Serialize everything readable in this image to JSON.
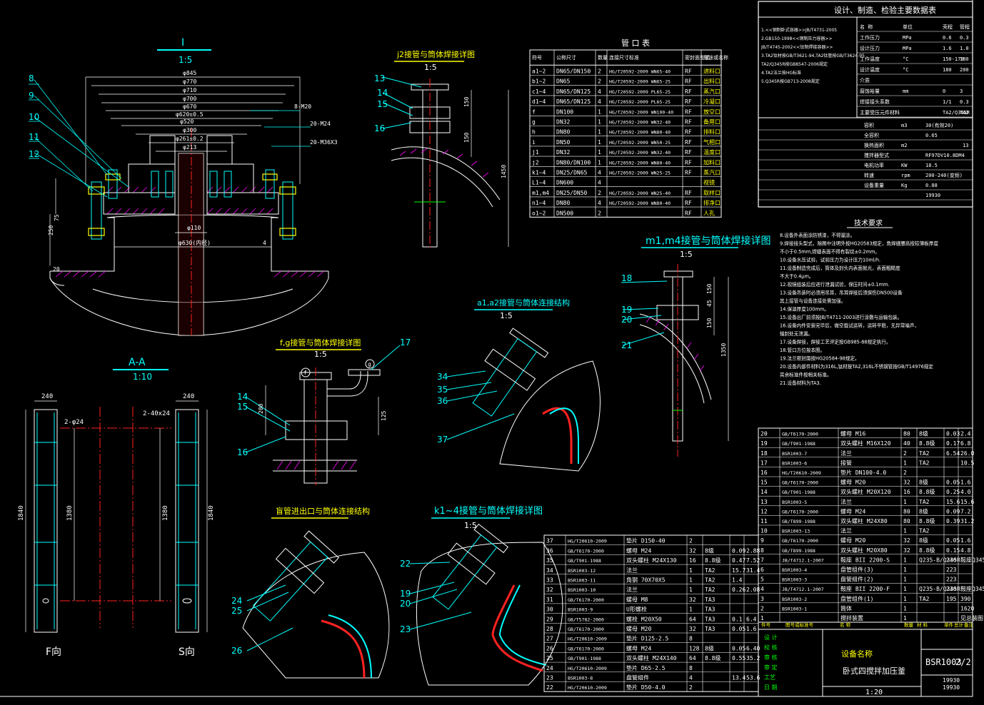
{
  "colors": {
    "bg": "#000000",
    "line": "#ffffff",
    "cyan": "#00ffff",
    "yellow": "#ffff00",
    "red": "#ff2020",
    "green": "#00ff00",
    "magenta": "#ff00ff",
    "blue": "#0080ff"
  },
  "views": {
    "section_I": {
      "title": "I",
      "scale": "1:5",
      "dims": [
        "φ845",
        "φ770",
        "φ710",
        "φ700",
        "φ670",
        "φ620±0.5",
        "φ520",
        "φ300",
        "φ261±0.2",
        "φ213",
        "φ110",
        "φ630(内径)",
        "250",
        "20",
        "75",
        "4",
        "8-M20",
        "20-M24",
        "20-M36X3"
      ],
      "callouts": [
        "8",
        "9",
        "10",
        "11",
        "12"
      ]
    },
    "section_AA": {
      "title": "A-A",
      "scale": "1:10",
      "left_label": "F向",
      "right_label": "S向",
      "dims": [
        "240",
        "240",
        "1840",
        "1840",
        "1380",
        "1380",
        "2-φ24",
        "2-40x24"
      ]
    },
    "j2": {
      "title": "j2接管与筒体焊接详图",
      "scale": "1:5",
      "callouts": [
        "13",
        "14",
        "15",
        "16"
      ],
      "dims": [
        "150",
        "150",
        "1450"
      ]
    },
    "fg": {
      "title": "f,g接管与筒体焊接详图",
      "scale": "1:5",
      "callouts": [
        "14",
        "15",
        "16",
        "17"
      ],
      "dims": [
        "200",
        "125"
      ]
    },
    "a12": {
      "title": "a1,a2接管与筒体连接结构",
      "scale": "1:5",
      "callouts": [
        "34",
        "35",
        "36",
        "37"
      ]
    },
    "m1m4": {
      "title": "m1,m4接管与筒体焊接详图",
      "scale": "1:5",
      "callouts": [
        "18",
        "19",
        "20",
        "21"
      ],
      "dims": [
        "150",
        "45",
        "150",
        "1350"
      ]
    },
    "blind": {
      "title": "盲管进出口与筒体连接结构",
      "callouts": [
        "24",
        "25",
        "26"
      ]
    },
    "k14": {
      "title": "k1~4接管与筒体焊接详图",
      "scale": "1:5",
      "callouts": [
        "22",
        "19",
        "20",
        "23"
      ]
    }
  },
  "nozzle_table": {
    "title": "管 口 表",
    "headers": [
      "符号",
      "公称尺寸",
      "数量",
      "连接尺寸标准",
      "密封面型式",
      "用途或名称"
    ],
    "rows": [
      [
        "a1~2",
        "DN65/DN150",
        "2",
        "HG/T20592-2009 WN65-40",
        "RF",
        "进料口"
      ],
      [
        "b1~2",
        "DN65",
        "2",
        "HG/T20592-2009 WN65-25",
        "RF",
        "出料口"
      ],
      [
        "c1~4",
        "DN65/DN125",
        "4",
        "HG/T20592-2009 PL65-25",
        "RF",
        "蒸汽口"
      ],
      [
        "d1~4",
        "DN65/DN125",
        "4",
        "HG/T20592-2009 PL65-25",
        "RF",
        "冷凝口"
      ],
      [
        "f",
        "DN100",
        "1",
        "HG/T20592-2009 WN100-40",
        "RF",
        "放空口"
      ],
      [
        "g",
        "DN32",
        "1",
        "HG/T20592-2009 WN32-40",
        "RF",
        "备用口"
      ],
      [
        "h",
        "DN80",
        "1",
        "HG/T20592-2009 WN80-40",
        "RF",
        "排料口"
      ],
      [
        "i",
        "DN50",
        "1",
        "HG/T20592-2009 WN50-25",
        "RF",
        "气相口"
      ],
      [
        "j1",
        "DN32",
        "1",
        "HG/T20592-2009 WN32-40",
        "RF",
        "温度口"
      ],
      [
        "j2",
        "DN80/DN100",
        "1",
        "HG/T20592-2009 WN80-40",
        "RF",
        "加料口"
      ],
      [
        "k1~4",
        "DN25/DN65",
        "4",
        "HG/T20592-2009 WN25-25",
        "RF",
        "蒸汽口"
      ],
      [
        "L1~4",
        "DN600",
        "4",
        "",
        "",
        "视镜"
      ],
      [
        "m1,m4",
        "DN25/DN50",
        "2",
        "HG/T20592-2009 WN25-40",
        "RF",
        "取样口"
      ],
      [
        "n1~4",
        "DN80",
        "4",
        "HG/T20592-2009 WN80-40",
        "RF",
        "排净口"
      ],
      [
        "o1~2",
        "DN500",
        "2",
        "",
        "RF",
        "人孔"
      ]
    ]
  },
  "design_table": {
    "title": "设计、制造、检验主要数据表",
    "left_lines": [
      "1.<<钢制卧式容器>>JB/T4731-2005",
      "2.GB150-1998<<钢制压力容器>>",
      "JB/T4745-2002<<钛制焊接容器>>",
      "3.TA2钛材按GB/T3621-94,TA2钛管按GB/T3624-95",
      "TA2/Q345R按GB8547-2006规定",
      "4.TA2法兰按HG标准",
      "5.Q345R按GB713-2008规定"
    ],
    "params": [
      [
        "名 称",
        "单位",
        "壳程",
        "管程"
      ],
      [
        "工作压力",
        "MPa",
        "0.6",
        "0.3"
      ],
      [
        "设计压力",
        "MPa",
        "1.6",
        "1.0"
      ],
      [
        "工作温度",
        "°C",
        "150-170",
        "180"
      ],
      [
        "设计温度",
        "°C",
        "180",
        "200"
      ],
      [
        "介质",
        "",
        "",
        ""
      ],
      [
        "腐蚀裕量",
        "mm",
        "0",
        "3"
      ],
      [
        "焊接接头系数",
        "",
        "1/1",
        "0.3"
      ],
      [
        "主要受压元件材料",
        "",
        "TA2/Q345R",
        "TA2"
      ]
    ],
    "extra": [
      [
        "容积",
        "m3",
        "30(有效20)"
      ],
      [
        "全容积",
        "",
        "0.65"
      ],
      [
        "换热面积",
        "m2",
        "",
        "13"
      ],
      [
        "搅拌器型式",
        "",
        "RF97DV10.8DM4"
      ],
      [
        "电机功率",
        "KW",
        "18.5"
      ],
      [
        "转速",
        "rpm",
        "200-240(变频)"
      ],
      [
        "设备重量",
        "Kg",
        "0.88"
      ],
      [
        "",
        "",
        "19930"
      ]
    ]
  },
  "notes": {
    "title": "技术要求",
    "lines": [
      "8.设备外表面涂防锈漆，不得漏涂。",
      "9.焊接接头型式，除图中注明外按HG20583规定，角焊缝腰高按较薄板厚度",
      "  不小于0.5mm,焊缝表面不得有裂纹±0.2mm。",
      "10.设备水压试验，试验压力为设计压力10ml/h.",
      "11.设备制造完成后，筒体及封头内表面抛光，表面粗糙度",
      "   不大于0.4μm。",
      "12.视镜组装后应进行泄漏试验，保压时间±0.1mm.",
      "13.设备吊装时必须用吊耳，吊耳焊接后须探伤DN500设备",
      "   其上接管与设备连接处需加强。",
      "14.保温厚度100mm。",
      "15.设备出厂前须按JB/T4711-2003进行涂敷与运输包装。",
      "16.设备内件安装完毕后，做空载试运转，运转平稳，无异常噪声，",
      "   轴封处无泄漏。",
      "17.设备焊接，焊接工艺评定按GB985-88规定执行。",
      "18.管口方位按本图。",
      "19.法兰密封面按HG20584-98规定。",
      "20.设备内部件材料为316L,钛材按TA2,316L不锈钢管按GB/T14976规定",
      "   其余标准件按相关标准。",
      "21.设备材料为TA3."
    ]
  },
  "parts_top": {
    "rows": [
      [
        "20",
        "GB/T6170-2000",
        "螺母 M16",
        "80",
        "8级",
        "0.03",
        "2.4"
      ],
      [
        "19",
        "GB/T901-1988",
        "双头螺柱 M16X120",
        "40",
        "8.8级",
        "0.17",
        "6.8"
      ],
      [
        "18",
        "BSR1003-7",
        "法兰",
        "2",
        "TA2",
        "6.54",
        "26.0"
      ],
      [
        "17",
        "BSR1003-6",
        "接管",
        "1",
        "TA2",
        "",
        "10.5"
      ],
      [
        "16",
        "HG/T20610-2009",
        "垫片 DN100-4.0",
        "2",
        "",
        "",
        ""
      ],
      [
        "15",
        "GB/T6170-2000",
        "螺母 M20",
        "32",
        "8级",
        "0.05",
        "1.6"
      ],
      [
        "14",
        "GB/T901-1988",
        "双头螺柱 M20X120",
        "16",
        "8.8级",
        "0.25",
        "4.0"
      ],
      [
        "13",
        "BSR1003-5",
        "法兰",
        "1",
        "TA2",
        "15.6",
        "15.6"
      ],
      [
        "12",
        "GB/T6170-2000",
        "螺母 M24",
        "80",
        "8级",
        "0.09",
        "7.2"
      ],
      [
        "11",
        "GB/T899-1988",
        "双头螺柱 M24X80",
        "80",
        "8.8级",
        "0.39",
        "31.2"
      ],
      [
        "10",
        "BSR1003-13",
        "法兰",
        "1",
        "TA2",
        "",
        ""
      ],
      [
        "9",
        "GB/T6170-2000",
        "螺母 M20",
        "32",
        "8级",
        "0.05",
        "1.6"
      ],
      [
        "8",
        "GB/T899-1988",
        "双头螺柱 M20X80",
        "32",
        "8.8级",
        "0.15",
        "4.8"
      ],
      [
        "7",
        "JB/T4712.1-2007",
        "鞍座 BII 2200-S",
        "1",
        "Q235-B/Q345R",
        "230",
        "鞍座Q345R"
      ],
      [
        "6",
        "BSR1003-4",
        "盘管组件(3)",
        "1",
        "",
        "223",
        ""
      ],
      [
        "5",
        "BSR1003-3",
        "盘管组件(2)",
        "1",
        "",
        "223",
        ""
      ],
      [
        "4",
        "JB/T4712.1-2007",
        "鞍座 BII 2200-F",
        "1",
        "Q235-B/Q345R",
        "230",
        "鞍座Q345R"
      ],
      [
        "3",
        "BSR1003-2",
        "盘管组件(1)",
        "1",
        "TA2",
        "195",
        "390"
      ],
      [
        "2",
        "BSR1003-1",
        "筒体",
        "1",
        "",
        "",
        "1620"
      ],
      [
        "1",
        "",
        "搅拌装置",
        "1",
        "",
        "",
        "见总装图"
      ]
    ],
    "header": [
      "件号",
      "图号或标准号",
      "名 称",
      "数量",
      "材 料",
      "单件",
      "总计",
      "备注"
    ]
  },
  "parts_bottom": {
    "rows": [
      [
        "37",
        "HG/T20610-2009",
        "垫片 D150-40",
        "2",
        "",
        "",
        ""
      ],
      [
        "36",
        "GB/T6170-2000",
        "螺母 M24",
        "32",
        "8级",
        "0.09",
        "2.88"
      ],
      [
        "35",
        "GB/T901-1988",
        "双头螺柱 M24X130",
        "16",
        "8.8级",
        "0.47",
        "7.52"
      ],
      [
        "34",
        "BSR1003-12",
        "法兰",
        "1",
        "TA2",
        "15.7",
        "31.4"
      ],
      [
        "33",
        "BSR1003-11",
        "角钢 70X70X5",
        "1",
        "TA2",
        "1.4",
        ""
      ],
      [
        "32",
        "BSR1003-10",
        "法兰",
        "1",
        "TA2",
        "0.26",
        "2.08"
      ],
      [
        "31",
        "GB/T6170-2000",
        "螺母 M8",
        "32",
        "TA3",
        "",
        ""
      ],
      [
        "30",
        "BSR1003-9",
        "U形螺栓",
        "1",
        "TA3",
        "",
        ""
      ],
      [
        "29",
        "GB/T5782-2000",
        "螺栓 M20X50",
        "64",
        "TA3",
        "0.1",
        "6.4"
      ],
      [
        "28",
        "GB/T6170-2000",
        "螺母 M20",
        "32",
        "TA3",
        "0.05",
        "1.6"
      ],
      [
        "27",
        "HG/T20610-2009",
        "垫片 D125-2.5",
        "8",
        "",
        "",
        ""
      ],
      [
        "26",
        "GB/T6170-2000",
        "螺母 M24",
        "128",
        "8级",
        "0.05",
        "6.40"
      ],
      [
        "25",
        "GB/T901-1988",
        "双头螺柱 M24X140",
        "64",
        "8.8级",
        "0.55",
        "35.2"
      ],
      [
        "24",
        "HG/T20610-2009",
        "垫片 D65-2.5",
        "8",
        "",
        "",
        ""
      ],
      [
        "23",
        "BSR1003-8",
        "盘管组件",
        "4",
        "",
        "13.4",
        "53.6"
      ],
      [
        "22",
        "HG/T20610-2009",
        "垫片 D50-4.0",
        "2",
        "",
        "",
        ""
      ]
    ]
  },
  "title_block": {
    "equipment_label": "设备名称",
    "equipment_name": "卧式四搅拌加压釜",
    "drawing_no": "BSR1003",
    "sheet": "2/2",
    "scale": "1:20",
    "weight1": "19930",
    "weight2": "19930",
    "left_labels": [
      "设 计",
      "校 核",
      "审 核",
      "审 定",
      "工艺",
      "日 期"
    ]
  }
}
